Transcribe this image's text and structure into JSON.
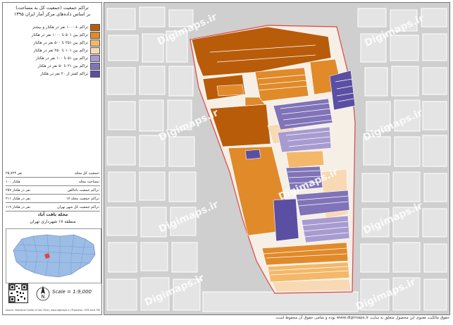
{
  "sidebar": {
    "title_line1": "تراکم جمعیت (جمعیت کل به مساحت)",
    "title_line2": "بر اساس داده‌های مرکز آمار ایران ۱۳۹۵",
    "legend": [
      {
        "label": "تراکم +۱۰۰۰ نفر در هکتار و بیشتر",
        "color": "#b85c0a"
      },
      {
        "label": "تراکم بین ۵۰۱ تا ۱۰۰۰ نفر در هکتار",
        "color": "#e08a2a"
      },
      {
        "label": "تراکم بین ۲۵۱ تا ۵۰۰ نفر در هکتار",
        "color": "#f4b86a"
      },
      {
        "label": "تراکم بین ۱۰۱ تا ۲۵۰ نفر در هکتار",
        "color": "#f7d9b4"
      },
      {
        "label": "تراکم بین ۵۱ تا ۱۰۰ نفر در هکتار",
        "color": "#a79bd0"
      },
      {
        "label": "تراکم بین ۲۱ تا ۵۰ نفر در هکتار",
        "color": "#8073b8"
      },
      {
        "label": "تراکم کمتر از ۲۰ نفر در هکتار",
        "color": "#5a4fa3"
      }
    ],
    "stats": [
      {
        "label": "جمعیت کل محله:",
        "value": "۲۵,۷۲۴ نفر"
      },
      {
        "label": "مساحت محله:",
        "value": "۱۰۰ هکتار"
      },
      {
        "label": "تراکم جمعیت ناخالص:",
        "value": "۲۵۷ نفر در هکتار"
      },
      {
        "label": "تراکم جمعیت محله ۱۷:",
        "value": "۲۱۱ نفر در هکتار"
      },
      {
        "label": "تراکم جمعیت کل شهر تهران:",
        "value": "۱۱۹ نفر در هکتار"
      }
    ],
    "region_name": "محله یافت آباد",
    "region_sub": "منطقه ۱۷ شهرداری تهران",
    "scale": "Scale = 1:9,000",
    "footer": "Source: Statistical Center of Iran 2016 | www.digimaps.ir | Projection: UTM Zone 39N"
  },
  "map": {
    "watermark": "Digimaps.ir",
    "background_color": "#cfcfcf",
    "boundary_color": "#e04545"
  },
  "copyright": "حقوق مالکیت معنوی این محصول متعلق به سایت www.digimaps.ir بوده و تمامی حقوق آن محفوظ است."
}
